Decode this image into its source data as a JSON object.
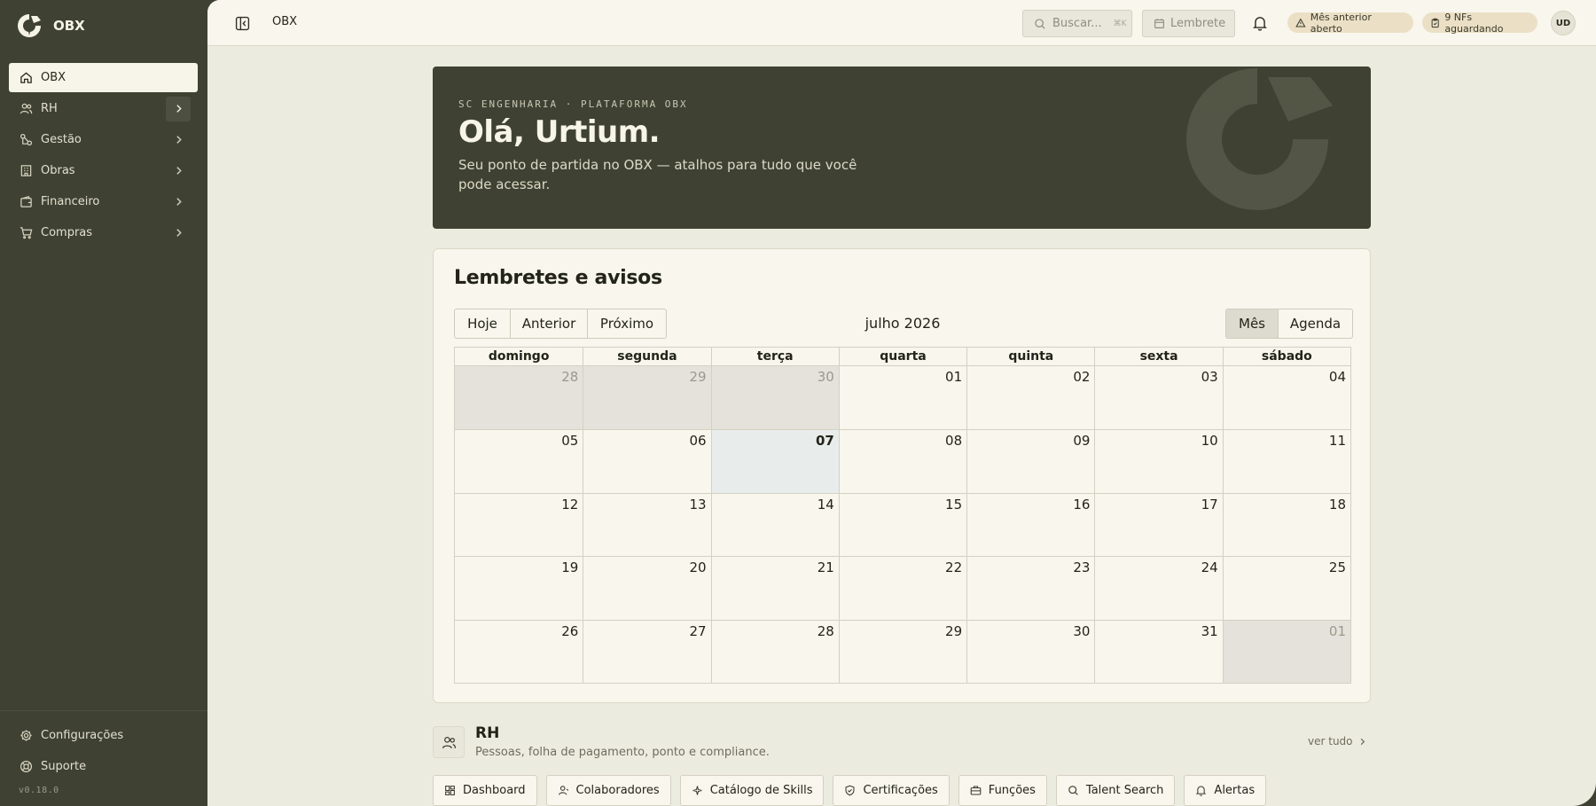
{
  "app": {
    "name": "OBX",
    "version": "v0.18.0"
  },
  "sidebar": {
    "items": [
      {
        "label": "OBX",
        "icon": "home-icon",
        "active": true
      },
      {
        "label": "RH",
        "icon": "users-icon",
        "has_children": true
      },
      {
        "label": "Gestão",
        "icon": "workflow-icon",
        "has_children": true
      },
      {
        "label": "Obras",
        "icon": "building-icon",
        "has_children": true
      },
      {
        "label": "Financeiro",
        "icon": "wallet-icon",
        "has_children": true
      },
      {
        "label": "Compras",
        "icon": "cart-icon",
        "has_children": true
      }
    ],
    "bottom_items": [
      {
        "label": "Configurações",
        "icon": "gear-icon"
      },
      {
        "label": "Suporte",
        "icon": "lifebuoy-icon"
      }
    ]
  },
  "topbar": {
    "title": "OBX",
    "search_label": "Buscar...",
    "search_shortcut": "⌘K",
    "reminder_label": "Lembrete",
    "alerts": [
      {
        "label": "Mês anterior aberto",
        "icon": "warning-icon"
      },
      {
        "label": "9 NFs aguardando",
        "icon": "clipboard-icon"
      }
    ],
    "avatar_initials": "UD"
  },
  "hero": {
    "eyebrow": "SC ENGENHARIA · PLATAFORMA OBX",
    "title": "Olá, Urtium.",
    "subtitle": "Seu ponto de partida no OBX — atalhos para tudo que você pode acessar."
  },
  "calendar": {
    "title": "Lembretes e avisos",
    "nav_buttons": [
      "Hoje",
      "Anterior",
      "Próximo"
    ],
    "view_buttons": [
      "Mês",
      "Agenda"
    ],
    "selected_view": "Mês",
    "month_label": "julho 2026",
    "weekdays": [
      "domingo",
      "segunda",
      "terça",
      "quarta",
      "quinta",
      "sexta",
      "sábado"
    ],
    "days": [
      {
        "d": "28",
        "off": true
      },
      {
        "d": "29",
        "off": true
      },
      {
        "d": "30",
        "off": true
      },
      {
        "d": "01"
      },
      {
        "d": "02"
      },
      {
        "d": "03"
      },
      {
        "d": "04"
      },
      {
        "d": "05"
      },
      {
        "d": "06"
      },
      {
        "d": "07",
        "today": true
      },
      {
        "d": "08"
      },
      {
        "d": "09"
      },
      {
        "d": "10"
      },
      {
        "d": "11"
      },
      {
        "d": "12"
      },
      {
        "d": "13"
      },
      {
        "d": "14"
      },
      {
        "d": "15"
      },
      {
        "d": "16"
      },
      {
        "d": "17"
      },
      {
        "d": "18"
      },
      {
        "d": "19"
      },
      {
        "d": "20"
      },
      {
        "d": "21"
      },
      {
        "d": "22"
      },
      {
        "d": "23"
      },
      {
        "d": "24"
      },
      {
        "d": "25"
      },
      {
        "d": "26"
      },
      {
        "d": "27"
      },
      {
        "d": "28"
      },
      {
        "d": "29"
      },
      {
        "d": "30"
      },
      {
        "d": "31"
      },
      {
        "d": "01",
        "off": true
      }
    ]
  },
  "rh_section": {
    "title": "RH",
    "subtitle": "Pessoas, folha de pagamento, ponto e compliance.",
    "see_all": "ver tudo",
    "shortcuts": [
      {
        "label": "Dashboard",
        "icon": "grid-icon"
      },
      {
        "label": "Colaboradores",
        "icon": "user-icon"
      },
      {
        "label": "Catálogo de Skills",
        "icon": "sparkle-icon"
      },
      {
        "label": "Certificações",
        "icon": "shield-check-icon"
      },
      {
        "label": "Funções",
        "icon": "briefcase-icon"
      },
      {
        "label": "Talent Search",
        "icon": "search-icon"
      },
      {
        "label": "Alertas",
        "icon": "bell-icon"
      }
    ]
  },
  "colors": {
    "sidebar_bg": "#3f4232",
    "main_bg": "#ecebdf",
    "surface": "#f8f6ed",
    "hero_bg": "#3f4232",
    "alert_pill": "#ebe0c6",
    "today_cell": "#e8edeb",
    "off_cell": "#e5e2db"
  }
}
